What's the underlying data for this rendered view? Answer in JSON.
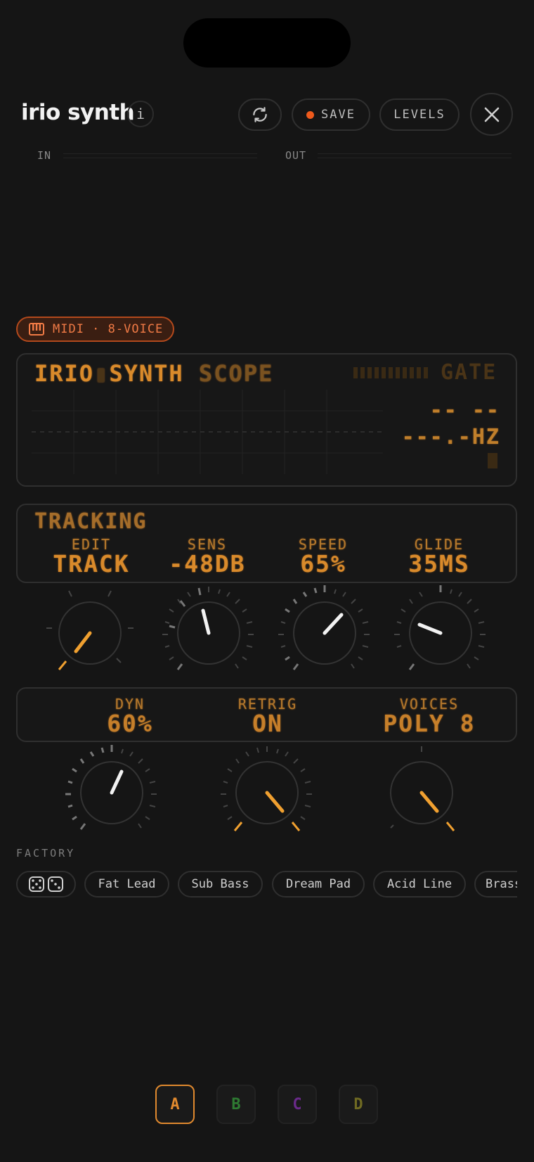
{
  "header": {
    "title": "irio synth",
    "info_label": "i",
    "save_label": "SAVE",
    "levels_label": "LEVELS"
  },
  "meters": {
    "in_label": "IN",
    "out_label": "OUT"
  },
  "midi_badge": {
    "label": "MIDI · 8-VOICE"
  },
  "scope": {
    "title_a": "IRIO",
    "title_b": "SYNTH",
    "title_c": "SCOPE",
    "gate_label": "GATE",
    "note_readout": "-- --",
    "hz_readout": "---.-HZ"
  },
  "tracking": {
    "heading": "TRACKING",
    "params": [
      {
        "label": "EDIT",
        "value": "TRACK"
      },
      {
        "label": "SENS",
        "value": "-48DB"
      },
      {
        "label": "SPEED",
        "value": "65%"
      },
      {
        "label": "GLIDE",
        "value": "35MS"
      }
    ]
  },
  "dynamics": {
    "params": [
      {
        "label": "DYN",
        "value": "60%"
      },
      {
        "label": "RETRIG",
        "value": "ON"
      },
      {
        "label": "VOICES",
        "value": "POLY 8"
      }
    ]
  },
  "presets": {
    "section_label": "FACTORY",
    "items": [
      "Fat Lead",
      "Sub Bass",
      "Dream Pad",
      "Acid Line",
      "Brass"
    ]
  },
  "slots": [
    "A",
    "B",
    "C",
    "D"
  ],
  "colors": {
    "accent": "#ee5a1c",
    "lcd": "#d98a2b",
    "slot_a": "#e0892e",
    "slot_b": "#2e7a32",
    "slot_c": "#6a2a8a",
    "slot_d": "#6f6a22"
  }
}
